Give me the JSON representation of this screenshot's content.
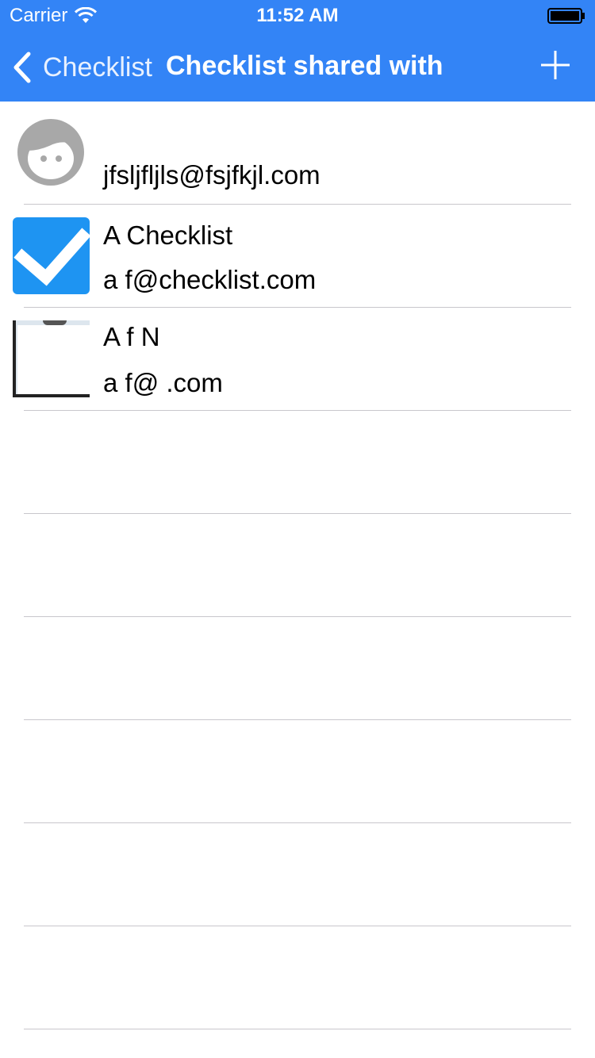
{
  "status_bar": {
    "carrier": "Carrier",
    "time": "11:52 AM"
  },
  "nav": {
    "back_label": "Checklist",
    "title": "Checklist shared with"
  },
  "rows": [
    {
      "name": "",
      "email": "jfsljfljls@fsjfkjl.com",
      "avatar": "default-face-icon"
    },
    {
      "name": "A     Checklist",
      "email": "a    f@checklist.com",
      "avatar": "checklist-app-icon"
    },
    {
      "name": "A    f N    ",
      "email": "a    f@          .com",
      "avatar": "photo-avatar"
    }
  ],
  "colors": {
    "nav_bg": "#3384f6",
    "checklist_icon_bg": "#1e94f2",
    "separator": "#c8c7cc"
  }
}
